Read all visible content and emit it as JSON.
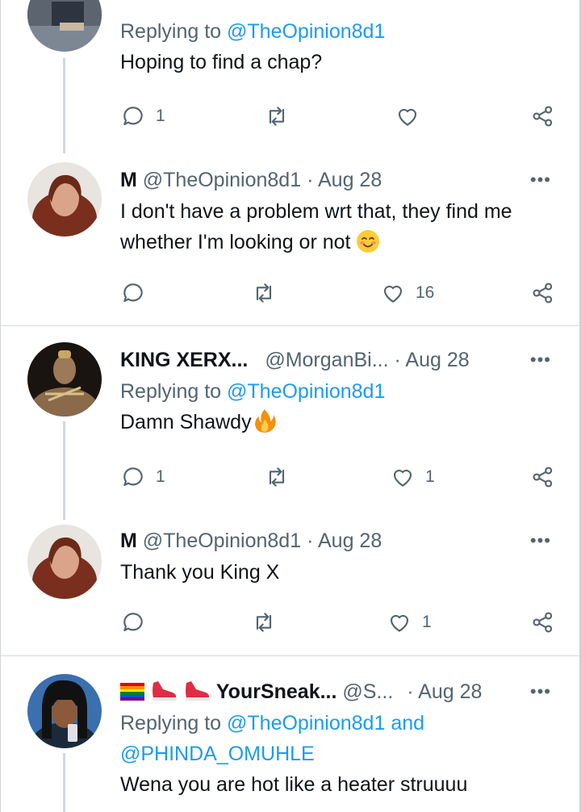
{
  "tweets": [
    {
      "reply_prefix": "Replying to ",
      "reply_mentions": [
        "@TheOpinion8d1"
      ],
      "text": "Hoping to find a chap?",
      "replies": "1",
      "likes": ""
    },
    {
      "name": "M",
      "handle": "@TheOpinion8d1",
      "dot": "·",
      "time": "Aug 28",
      "text": "I don't have a problem wrt that, they find me whether I'm looking or not",
      "emoji": "smiling-face-with-smiling-eyes",
      "replies": "",
      "likes": "16"
    },
    {
      "name": "KING XERX...",
      "handle": "@MorganBi...",
      "dot": "·",
      "time": "Aug 28",
      "reply_prefix": "Replying to ",
      "reply_mentions": [
        "@TheOpinion8d1"
      ],
      "text": "Damn Shawdy",
      "emoji": "fire",
      "replies": "1",
      "likes": "1"
    },
    {
      "name": "M",
      "handle": "@TheOpinion8d1",
      "dot": "·",
      "time": "Aug 28",
      "text": "Thank you King X",
      "replies": "",
      "likes": "1"
    },
    {
      "name": "YourSneak...",
      "name_emojis": [
        "rainbow-flag",
        "sneaker",
        "sneaker"
      ],
      "handle": "@S...",
      "dot": "·",
      "time": "Aug 28",
      "reply_prefix": "Replying to ",
      "reply_mentions": [
        "@TheOpinion8d1",
        "@PHINDA_OMUHLE"
      ],
      "reply_joiner": "and",
      "text": "Wena you are hot like a heater struuuu"
    }
  ],
  "more_label": "•••",
  "colors": {
    "accent": "#1d9bf0",
    "muted": "#536471",
    "text": "#0f1419",
    "thread": "#cfd9de"
  }
}
